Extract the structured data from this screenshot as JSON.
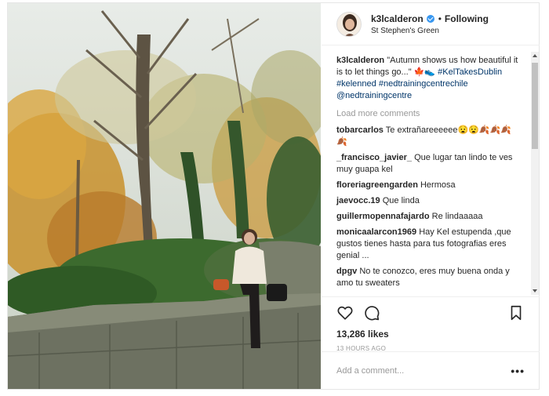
{
  "header": {
    "username": "k3lcalderon",
    "separator": "•",
    "follow_label": "Following",
    "location": "St Stephen's Green"
  },
  "caption": {
    "username": "k3lcalderon",
    "text": "\"Autumn shows us how beautiful it is to let things go...\" 🍁👟",
    "hashtags": [
      "#KelTakesDublin",
      "#kelenned",
      "#nedtrainingcentrechile"
    ],
    "mention": "@nedtrainingcentre"
  },
  "load_more": "Load more comments",
  "comments": [
    {
      "user": "tobarcarlos",
      "text": "Te extrañareeeeee😧😧🍂🍂🍂🍂"
    },
    {
      "user": "_francisco_javier_",
      "text": "Que lugar tan lindo te ves muy guapa kel"
    },
    {
      "user": "floreriagreengarden",
      "text": "Hermosa"
    },
    {
      "user": "jaevocc.19",
      "text": "Que linda"
    },
    {
      "user": "guillermopennafajardo",
      "text": "Re lindaaaaa"
    },
    {
      "user": "monicaalarcon1969",
      "text": "Hay Kel estupenda ,que gustos tienes hasta para tus fotografias eres genial ..."
    },
    {
      "user": "dpgv",
      "text": "No te conozco, eres muy buena onda y amo tu sweaters"
    }
  ],
  "likes": "13,286 likes",
  "timestamp": "13 HOURS AGO",
  "add_comment_placeholder": "Add a comment...",
  "more_label": "•••",
  "icons": {
    "like": "heart-icon",
    "comment": "comment-icon",
    "save": "bookmark-icon",
    "verified": "verified-badge-icon"
  },
  "colors": {
    "link": "#003569",
    "verified": "#3897f0",
    "muted": "#999999",
    "text": "#262626"
  }
}
